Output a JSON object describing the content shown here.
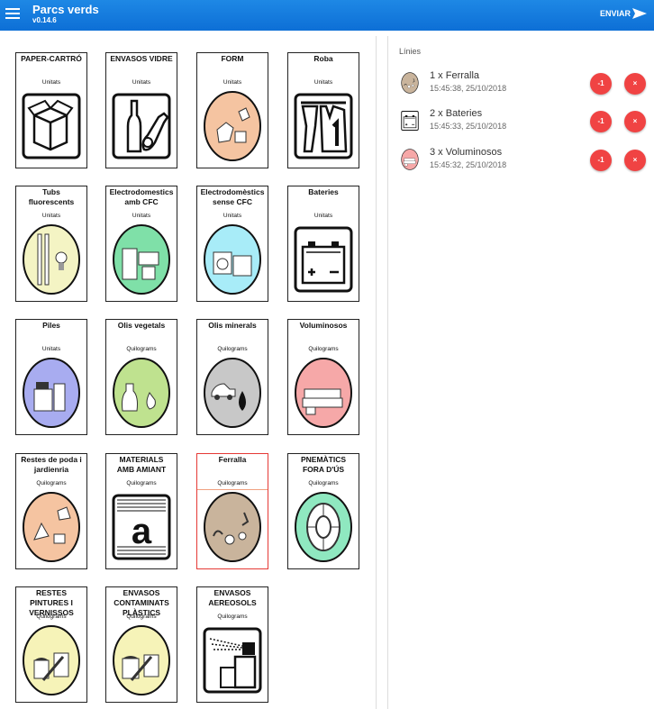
{
  "header": {
    "title": "Parcs verds",
    "version": "v0.14.6",
    "send_label": "ENVIAR"
  },
  "categories": [
    {
      "title": "PAPER-CARTRÓ",
      "unit": "Unitats",
      "icon": "paper-box-icon"
    },
    {
      "title": "ENVASOS VIDRE",
      "unit": "Unitats",
      "icon": "glass-bottles-icon"
    },
    {
      "title": "FORM",
      "unit": "Unitats",
      "icon": "furniture-icon",
      "color": "#f5c4a1"
    },
    {
      "title": "Roba",
      "unit": "Unitats",
      "icon": "clothes-icon"
    },
    {
      "title": "Tubs\nfluorescents",
      "unit": "Unitats",
      "icon": "fluorescent-tubes-icon",
      "color": "#f4f4c4"
    },
    {
      "title": "Electrodomestics\namb CFC",
      "unit": "Unitats",
      "icon": "fridge-icon",
      "color": "#7fe0a8"
    },
    {
      "title": "Electrodomèstics\nsense CFC",
      "unit": "Unitats",
      "icon": "washing-machine-icon",
      "color": "#a8ecf8"
    },
    {
      "title": "Bateries",
      "unit": "Unitats",
      "icon": "battery-icon"
    },
    {
      "title": "Piles",
      "unit": "Unitats",
      "icon": "piles-icon",
      "color": "#a8acf0"
    },
    {
      "title": "Olis vegetals",
      "unit": "Quilograms",
      "icon": "vegetable-oil-icon",
      "color": "#bfe28f"
    },
    {
      "title": "Olis minerals",
      "unit": "Quilograms",
      "icon": "mineral-oil-icon",
      "color": "#c8c8c8"
    },
    {
      "title": "Voluminosos",
      "unit": "Quilograms",
      "icon": "sofa-icon",
      "color": "#f6a8a8"
    },
    {
      "title": "Restes de poda i\njardienria",
      "unit": "Quilograms",
      "icon": "garden-icon",
      "color": "#f5c4a1"
    },
    {
      "title": "MATERIALS\nAMB AMIANT",
      "unit": "Quilograms",
      "icon": "asbestos-icon"
    },
    {
      "title": "Ferralla",
      "unit": "Quilograms",
      "icon": "scrap-metal-icon",
      "color": "#c9b49c",
      "selected": true
    },
    {
      "title": "PNEMÀTICS\nFORA D'ÚS",
      "unit": "Quilograms",
      "icon": "tyre-icon",
      "color": "#8fe8c0"
    },
    {
      "title": "RESTES\nPINTURES I\nVERNISSOS",
      "unit": "Quilograms",
      "icon": "paint-icon",
      "color": "#f6f3b8"
    },
    {
      "title": "ENVASOS\nCONTAMINATS\nPLÀSTICS",
      "unit": "Quilograms",
      "icon": "contaminated-containers-icon",
      "color": "#f6f3b8"
    },
    {
      "title": "ENVASOS\nAEREOSOLS",
      "unit": "Quilograms",
      "icon": "aerosol-icon"
    }
  ],
  "lines": {
    "title": "Línies",
    "items": [
      {
        "label": "1 x Ferralla",
        "time": "15:45:38, 25/10/2018",
        "minus_label": "-1",
        "delete_label": "×",
        "icon": "scrap-metal-icon",
        "color": "#c9b49c"
      },
      {
        "label": "2 x Bateries",
        "time": "15:45:33, 25/10/2018",
        "minus_label": "-1",
        "delete_label": "×",
        "icon": "battery-icon",
        "color": "#ffffff"
      },
      {
        "label": "3 x Voluminosos",
        "time": "15:45:32, 25/10/2018",
        "minus_label": "-1",
        "delete_label": "×",
        "icon": "sofa-icon",
        "color": "#f6a8a8"
      }
    ]
  }
}
